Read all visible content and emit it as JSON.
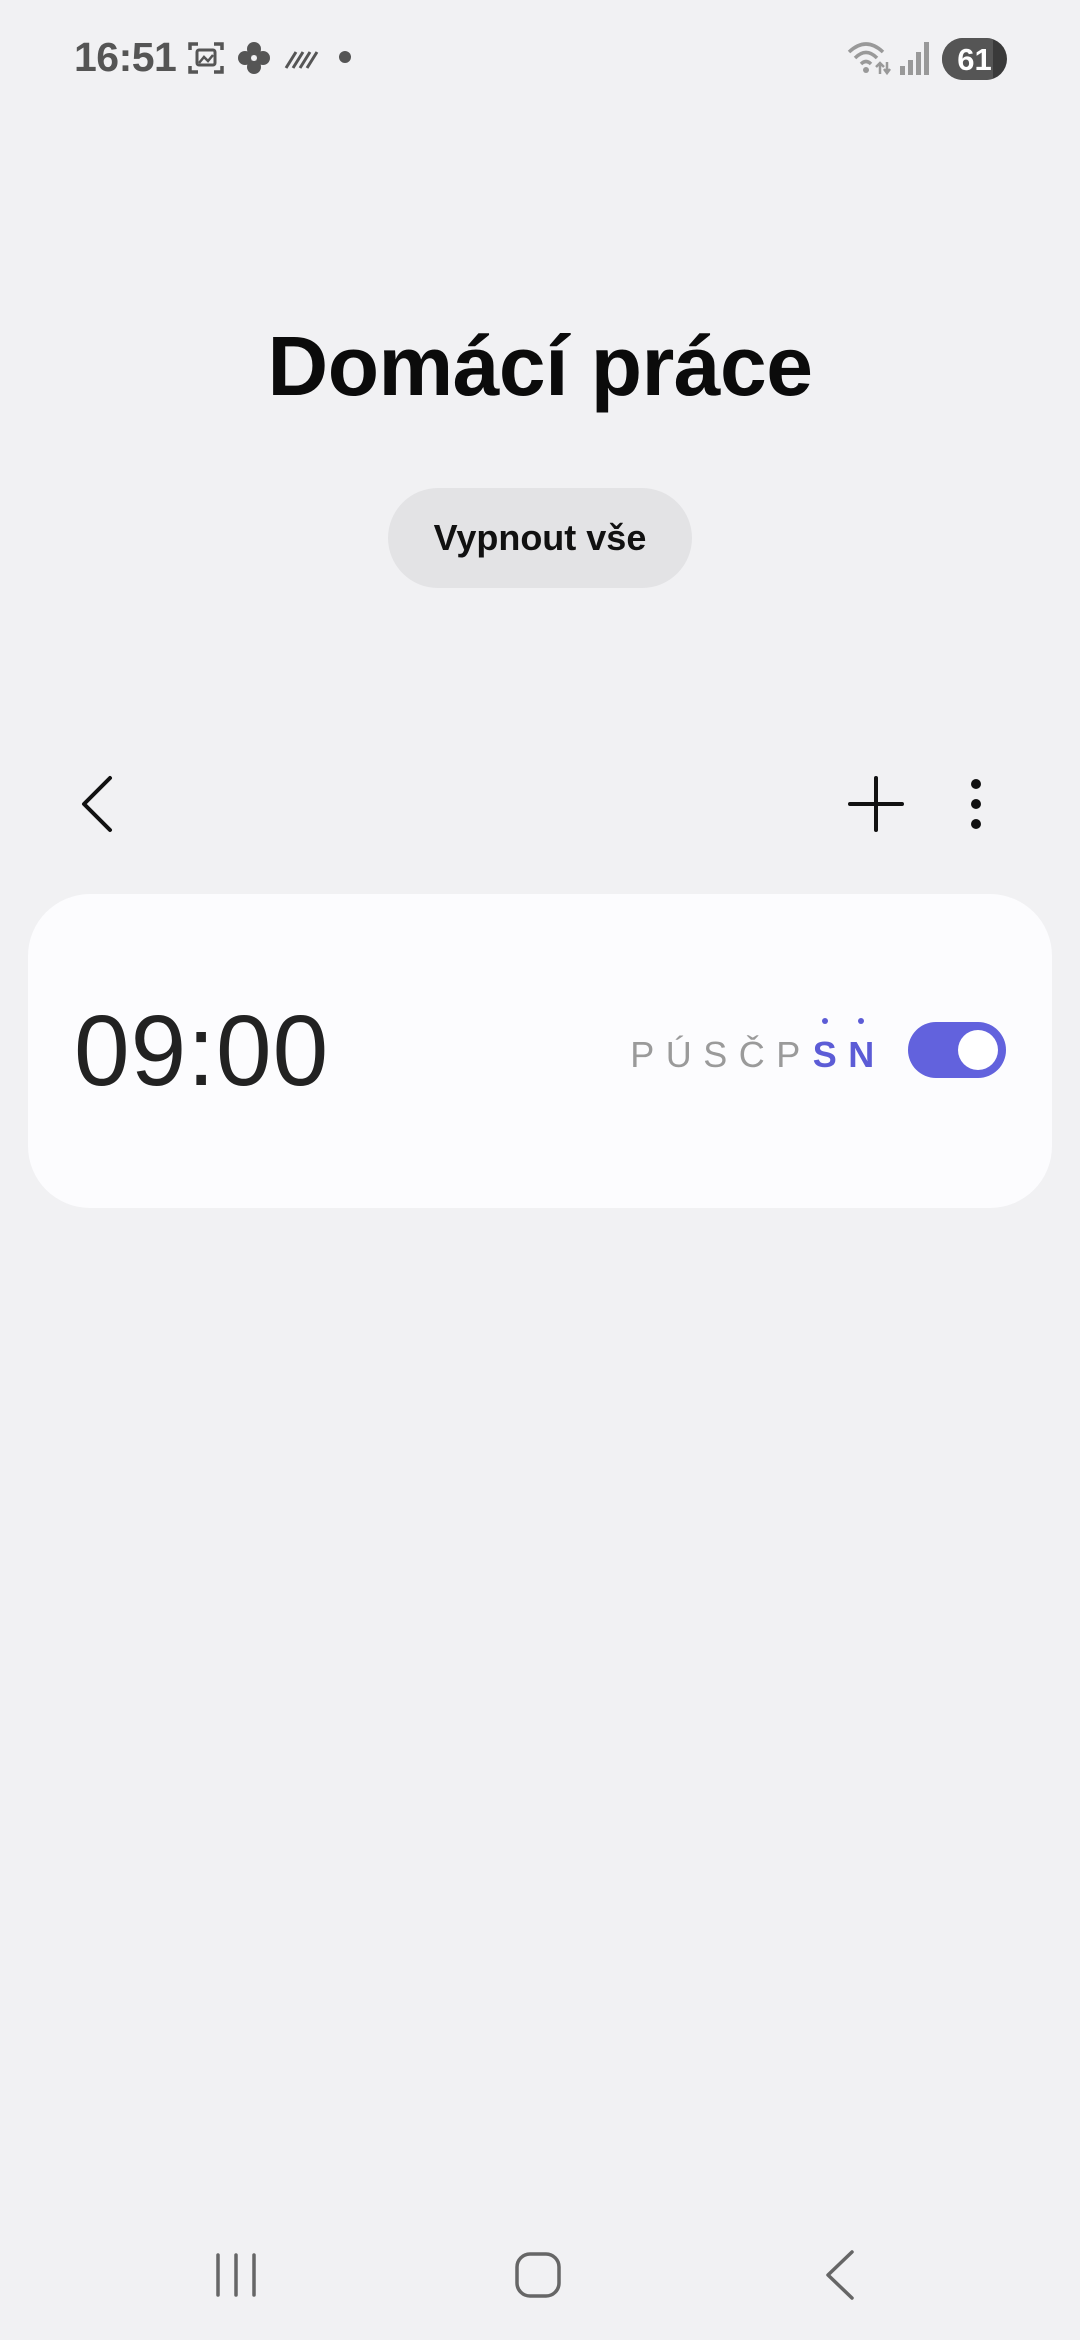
{
  "status_bar": {
    "time": "16:51",
    "icons": [
      "screenshot-icon",
      "pinwheel-icon",
      "nfc-icon",
      "notification-dot-icon",
      "wifi-icon",
      "signal-icon"
    ],
    "battery": "61"
  },
  "header": {
    "title": "Domácí práce",
    "turn_off_all_label": "Vypnout vše"
  },
  "toolbar": {
    "icons": [
      "back-icon",
      "add-icon",
      "more-icon"
    ]
  },
  "alarm": {
    "time": "09:00",
    "days": [
      {
        "label": "P",
        "active": false
      },
      {
        "label": "Ú",
        "active": false
      },
      {
        "label": "S",
        "active": false
      },
      {
        "label": "Č",
        "active": false
      },
      {
        "label": "P",
        "active": false
      },
      {
        "label": "S",
        "active": true
      },
      {
        "label": "N",
        "active": true
      }
    ],
    "enabled": true
  },
  "nav_bar": {
    "icons": [
      "recents-icon",
      "home-icon",
      "back-nav-icon"
    ]
  },
  "colors": {
    "background": "#f1f1f3",
    "card": "#fcfcfe",
    "accent": "#6262dd",
    "active_day": "#5c5cd6",
    "inactive_day": "#9a9a9a"
  }
}
